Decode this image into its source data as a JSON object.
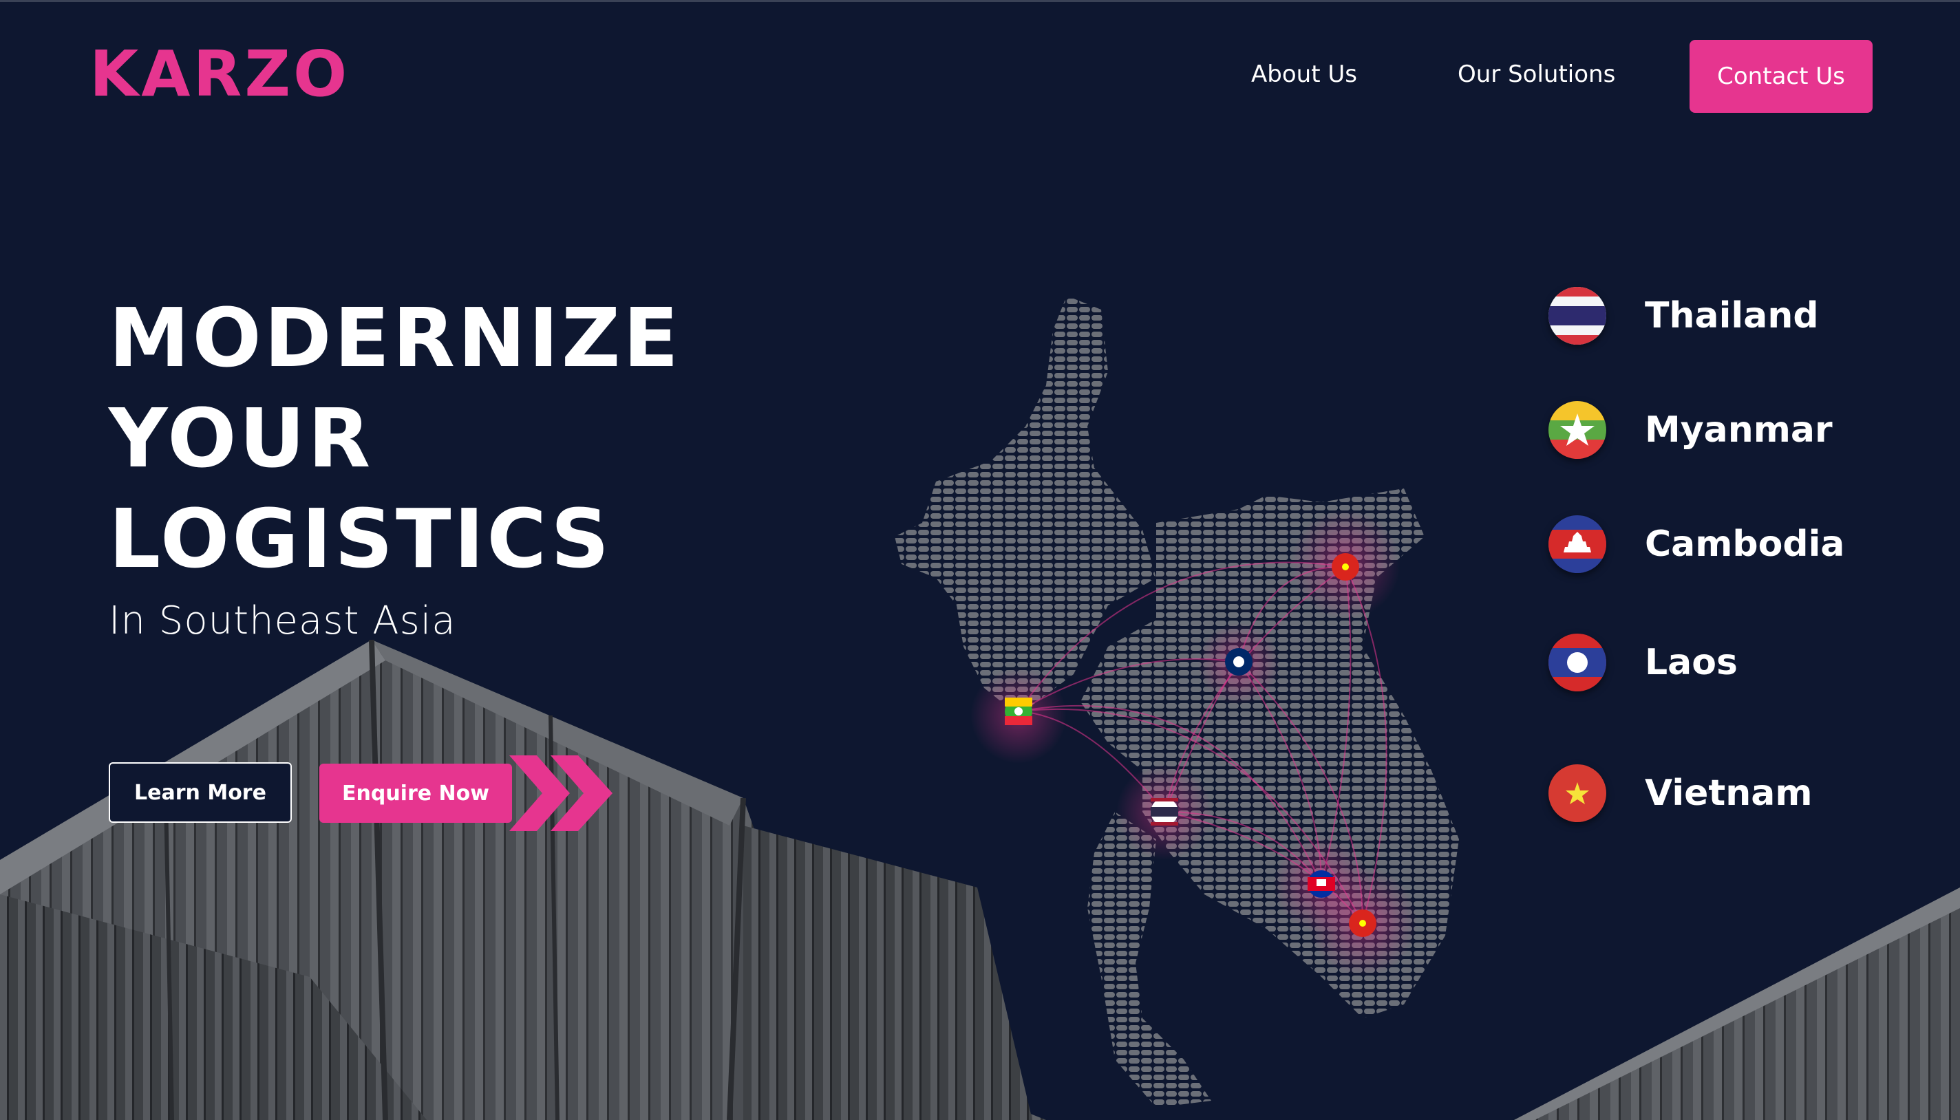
{
  "header": {
    "logo": "KARZO",
    "nav": [
      {
        "label": "About Us"
      },
      {
        "label": "Our Solutions"
      }
    ],
    "contact_label": "Contact Us"
  },
  "hero": {
    "title_lines": [
      "MODERNIZE",
      "YOUR",
      "LOGISTICS"
    ],
    "subtitle": "In Southeast Asia",
    "learn_more_label": "Learn More",
    "enquire_label": "Enquire Now"
  },
  "countries": [
    {
      "name": "Thailand",
      "icon": "thailand-flag-icon"
    },
    {
      "name": "Myanmar",
      "icon": "myanmar-flag-icon"
    },
    {
      "name": "Cambodia",
      "icon": "cambodia-flag-icon"
    },
    {
      "name": "Laos",
      "icon": "laos-flag-icon"
    },
    {
      "name": "Vietnam",
      "icon": "vietnam-flag-icon"
    }
  ],
  "colors": {
    "background": "#0e1730",
    "accent": "#e6358f",
    "text": "#ffffff",
    "map_dots": "#6b6f78"
  }
}
